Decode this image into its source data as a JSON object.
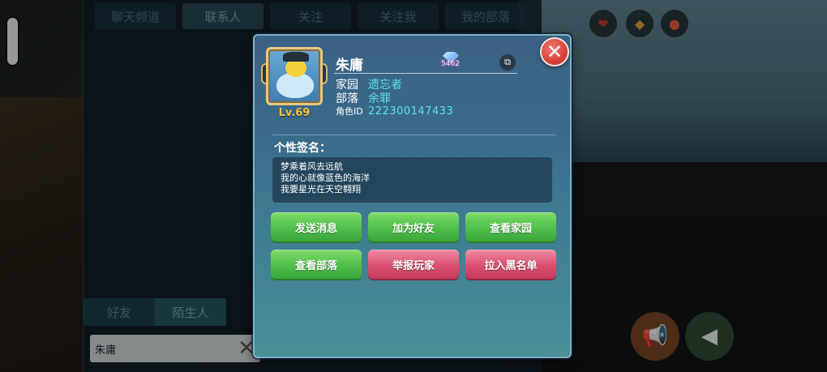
{
  "chat": {
    "tabs": [
      "聊天频道",
      "联系人",
      "关注",
      "关注我",
      "我的部落"
    ],
    "friend_tabs": [
      "好友",
      "陌生人"
    ],
    "search_value": "朱庸"
  },
  "profile": {
    "name": "朱庸",
    "level": "Lv.69",
    "diamond_count": "5462",
    "home_label": "家园",
    "home_value": "遗忘者",
    "tribe_label": "部落",
    "tribe_value": "余罪",
    "role_id_label": "角色ID",
    "role_id_value": "222300147433",
    "signature_title": "个性签名：",
    "signature_lines": [
      "梦乘着风去远航",
      "我的心就像蓝色的海洋",
      "我要星光在天空翱翔"
    ]
  },
  "buttons": {
    "send_message": "发送消息",
    "add_friend": "加为好友",
    "view_home": "查看家园",
    "view_tribe": "查看部落",
    "report_player": "举报玩家",
    "blacklist": "拉入黑名单"
  },
  "icons": {
    "close": "close-icon",
    "copy": "copy-icon",
    "diamond": "diamond-icon",
    "search_clear": "clear-icon"
  },
  "colors": {
    "accent_cyan": "#5fe1e6",
    "level_gold": "#f5c242",
    "green_button": "#4fbf4b",
    "red_button": "#d9506f"
  }
}
